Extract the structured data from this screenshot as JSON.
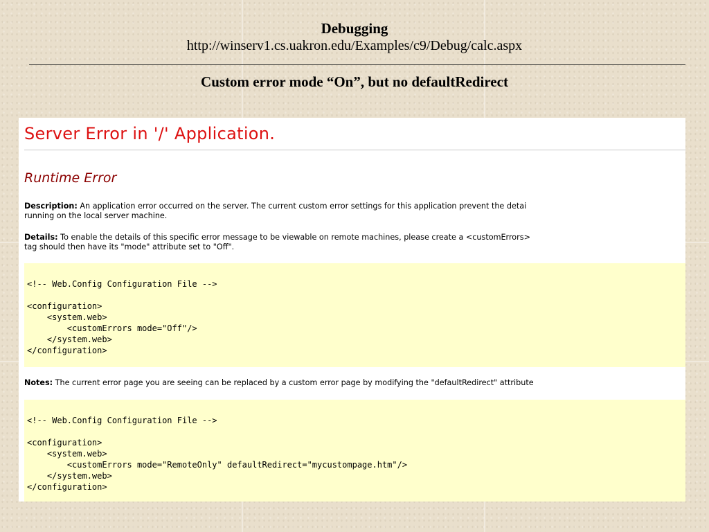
{
  "slide": {
    "title": "Debugging",
    "url": "http://winserv1.cs.uakron.edu/Examples/c9/Debug/calc.aspx",
    "subtitle": "Custom error mode “On”, but no defaultRedirect"
  },
  "error_page": {
    "heading": "Server Error in '/' Application.",
    "subheading": "Runtime Error",
    "description": {
      "label": "Description:",
      "line1": " An application error occurred on the server. The current custom error settings for this application prevent the detai",
      "line2": "running on the local server machine."
    },
    "details": {
      "label": "Details:",
      "line1": " To enable the details of this specific error message to be viewable on remote machines, please create a <customErrors>",
      "line2": "tag should then have its \"mode\" attribute set to \"Off\"."
    },
    "code_block_1": {
      "comment": "<!-- Web.Config Configuration File -->",
      "line1": "<configuration>",
      "line2": "    <system.web>",
      "line3": "        <customErrors mode=\"Off\"/>",
      "line4": "    </system.web>",
      "line5": "</configuration>"
    },
    "notes": {
      "label": "Notes:",
      "line1": " The current error page you are seeing can be replaced by a custom error page by modifying the \"defaultRedirect\" attribute"
    },
    "code_block_2": {
      "comment": "<!-- Web.Config Configuration File -->",
      "line1": "<configuration>",
      "line2": "    <system.web>",
      "line3": "        <customErrors mode=\"RemoteOnly\" defaultRedirect=\"mycustompage.htm\"/>",
      "line4": "    </system.web>",
      "line5": "</configuration>"
    }
  }
}
